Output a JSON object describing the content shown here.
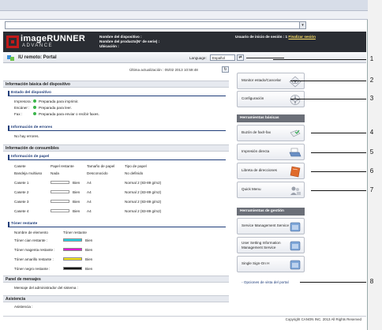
{
  "header": {
    "brand_main": "imageRUNNER",
    "brand_sub": "ADVANCE",
    "device_name_label": "Nombre del dispositivo :",
    "product_name_label": "Nombre del producto(N° de serie) :",
    "location_label": "Ubicación :",
    "user_label": "Usuario de inicio de sesión : 1",
    "logout_link": "Finalizar sesión"
  },
  "portal": {
    "title": "IU remoto: Portal",
    "language_label": "Language:",
    "language_value": "Español"
  },
  "main": {
    "last_update": "Última actualización : 05/02 2013 10:59:48",
    "basic_info_title": "Información básica del dispositivo",
    "device_status_title": "Estado del dispositivo",
    "status_rows": [
      {
        "label": "Impresora :",
        "value": "Preparada para imprimir."
      },
      {
        "label": "Escáner :",
        "value": "Preparada para leer."
      },
      {
        "label": "Fax :",
        "value": "Preparada para enviar o recibir faxes."
      }
    ],
    "errors_title": "Información de errores",
    "errors_value": "No hay errores.",
    "consumables_title": "Información de consumibles",
    "paper_title": "Información de papel",
    "paper_headers": [
      "Casete",
      "Papel restante",
      "Tamaño de papel",
      "Tipo de papel"
    ],
    "paper_rows": [
      {
        "cassette": "Bandeja multiuso",
        "remaining": "Nada",
        "size": "Desconocido",
        "type": "No definido",
        "bar": false
      },
      {
        "cassette": "Casete 1",
        "remaining": "Bien",
        "size": "A4",
        "type": "Normal 2 (83-89 g/m2)",
        "bar": true
      },
      {
        "cassette": "Casete 2",
        "remaining": "Bien",
        "size": "A4",
        "type": "Normal 2 (83-89 g/m2)",
        "bar": true
      },
      {
        "cassette": "Casete 3",
        "remaining": "Bien",
        "size": "A4",
        "type": "Normal 2 (83-89 g/m2)",
        "bar": true
      },
      {
        "cassette": "Casete 4",
        "remaining": "Bien",
        "size": "A4",
        "type": "Normal 2 (83-89 g/m2)",
        "bar": true
      }
    ],
    "toner_title": "Tóner restante",
    "toner_headers": [
      "Nombre de elemento",
      "Tóner restante"
    ],
    "toner_rows": [
      {
        "name": "Tóner cian restante :",
        "value": "Bien",
        "color": "#22d3e6"
      },
      {
        "name": "Tóner magenta restante :",
        "value": "Bien",
        "color": "#e11ad8"
      },
      {
        "name": "Tóner amarillo restante :",
        "value": "Bien",
        "color": "#f4e514"
      },
      {
        "name": "Tóner negro restante :",
        "value": "Bien",
        "color": "#111111"
      }
    ],
    "messages_title": "Panel de mensajes",
    "messages_value": "Mensaje del administrador del sistema :",
    "support_title": "Asistencia",
    "support_value": "Asistencia :"
  },
  "side": {
    "monitor": "Monitor estado/Cancelar",
    "settings": "Configuración",
    "basic_tools_title": "Herramientas básicas",
    "mailbox": "Buzón de fax/I-fax",
    "direct_print": "Impresión directa",
    "address_book": "Libreta de direcciones",
    "quick_menu": "Quick Menu",
    "mgmt_tools_title": "Herramientas de gestión",
    "service_mgmt": "Service Management Service",
    "user_setting": "User Setting Information Management Service",
    "sso": "Single Sign-On H",
    "portal_options": "Opciones de vista del portal"
  },
  "callouts": [
    "1",
    "2",
    "3",
    "4",
    "5",
    "6",
    "7",
    "8"
  ],
  "footer": {
    "copyright": "Copyright CANON INC. 2013 All Rights Reserved"
  }
}
